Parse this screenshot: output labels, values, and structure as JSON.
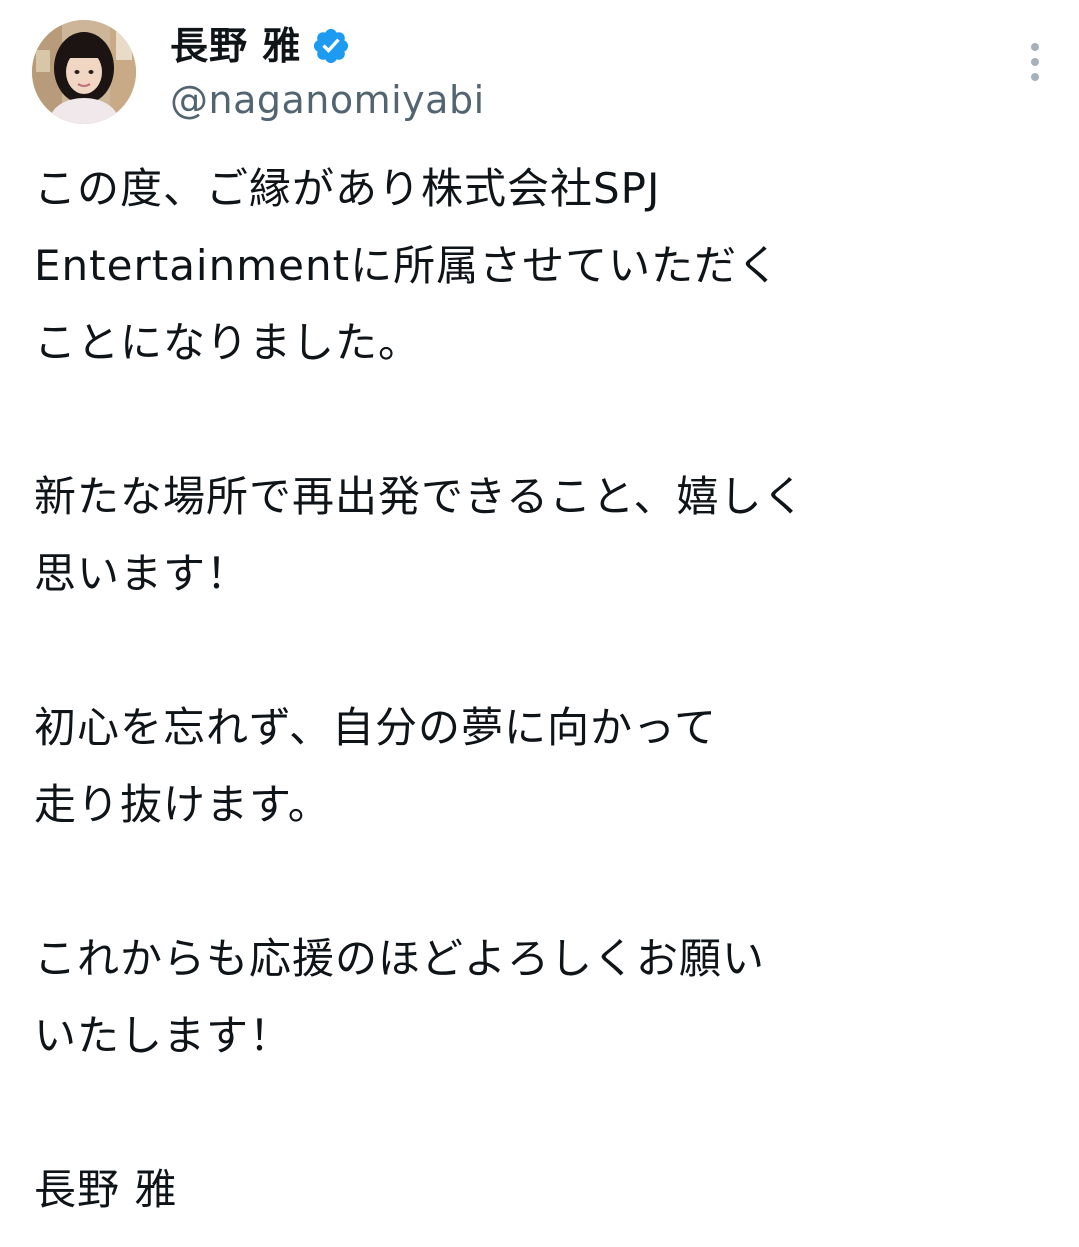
{
  "author": {
    "display_name": "長野 雅",
    "handle": "@naganomiyabi",
    "verified": true,
    "verified_color": "#1d9bf0"
  },
  "icons": {
    "verified": "verified-badge-icon",
    "more": "more-vertical-icon"
  },
  "tweet": {
    "lines": [
      "この度、ご縁があり株式会社SPJ",
      "Entertainmentに所属させていただく",
      "ことになりました。",
      "",
      "新たな場所で再出発できること、嬉しく",
      "思います！",
      "",
      "初心を忘れず、自分の夢に向かって",
      "走り抜けます。",
      "",
      "これからも応援のほどよろしくお願い",
      "いたします！",
      "",
      "長野 雅"
    ]
  }
}
